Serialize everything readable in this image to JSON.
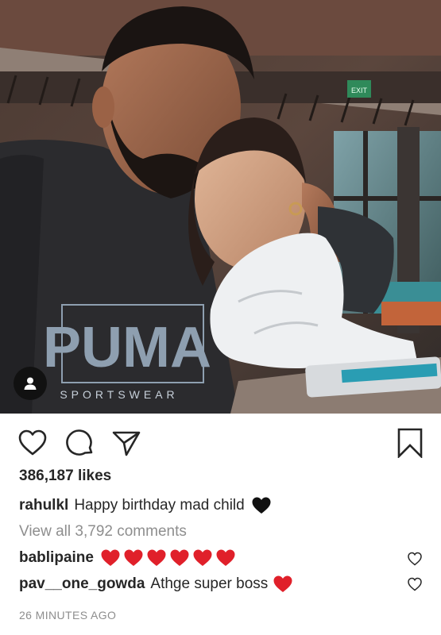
{
  "post": {
    "photo_description": "selfie photo",
    "shirt_text_brand": "PUMA",
    "shirt_text_sub": "SPORTSWEAR",
    "exit_sign_text": "EXIT"
  },
  "actions": {
    "like_icon": "heart-outline-icon",
    "comment_icon": "speech-bubble-icon",
    "share_icon": "paper-plane-icon",
    "save_icon": "bookmark-icon"
  },
  "likes_text": "386,187 likes",
  "caption": {
    "username": "rahulkl",
    "text": "Happy birthday mad child",
    "emoji": "black-heart"
  },
  "view_all_comments": "View all 3,792 comments",
  "comments": [
    {
      "username": "bablipaine",
      "text": "",
      "emoji_count": 6,
      "emoji": "red-heart"
    },
    {
      "username": "pav__one_gowda",
      "text": "Athge super boss",
      "emoji_count": 1,
      "emoji": "red-heart"
    }
  ],
  "timestamp": "26 MINUTES AGO",
  "colors": {
    "text": "#262626",
    "muted": "#8e8e8e",
    "heart_red": "#e0202a",
    "black_heart": "#111111"
  }
}
